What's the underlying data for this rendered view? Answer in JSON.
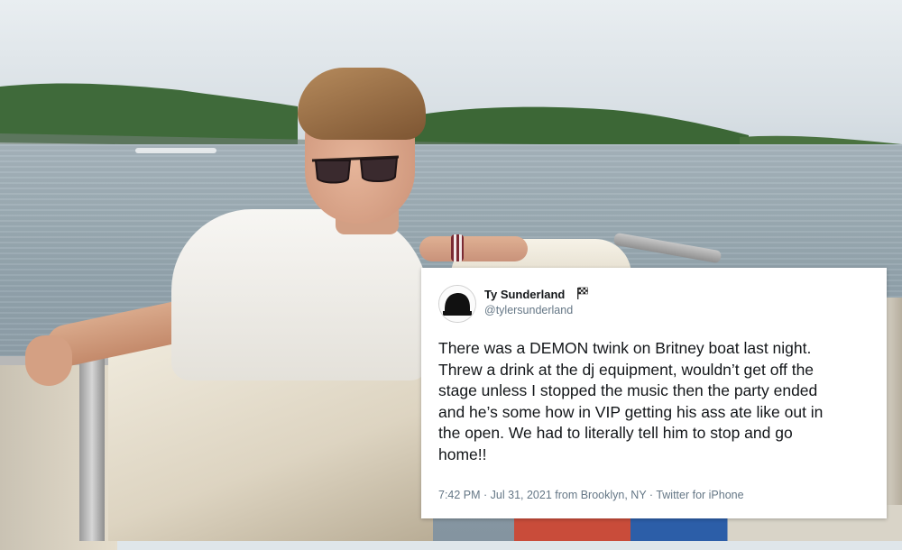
{
  "tweet": {
    "author_name": "Ty Sunderland",
    "author_handle": "@tylersunderland",
    "author_badge_icon": "checkered-flag-icon",
    "body": "There was a DEMON twink on Britney boat last night.\nThrew a drink at the dj equipment, wouldn’t get off the\nstage unless I stopped the music then the party ended\nand he’s some how in VIP getting his ass ate like out in\nthe open. We had to literally tell him to stop and go\nhome!!",
    "meta": "7:42 PM · Jul 31, 2021 from Brooklyn, NY · Twitter for iPhone"
  },
  "colors": {
    "text_primary": "#14171a",
    "text_secondary": "#657786",
    "card_background": "#ffffff"
  }
}
